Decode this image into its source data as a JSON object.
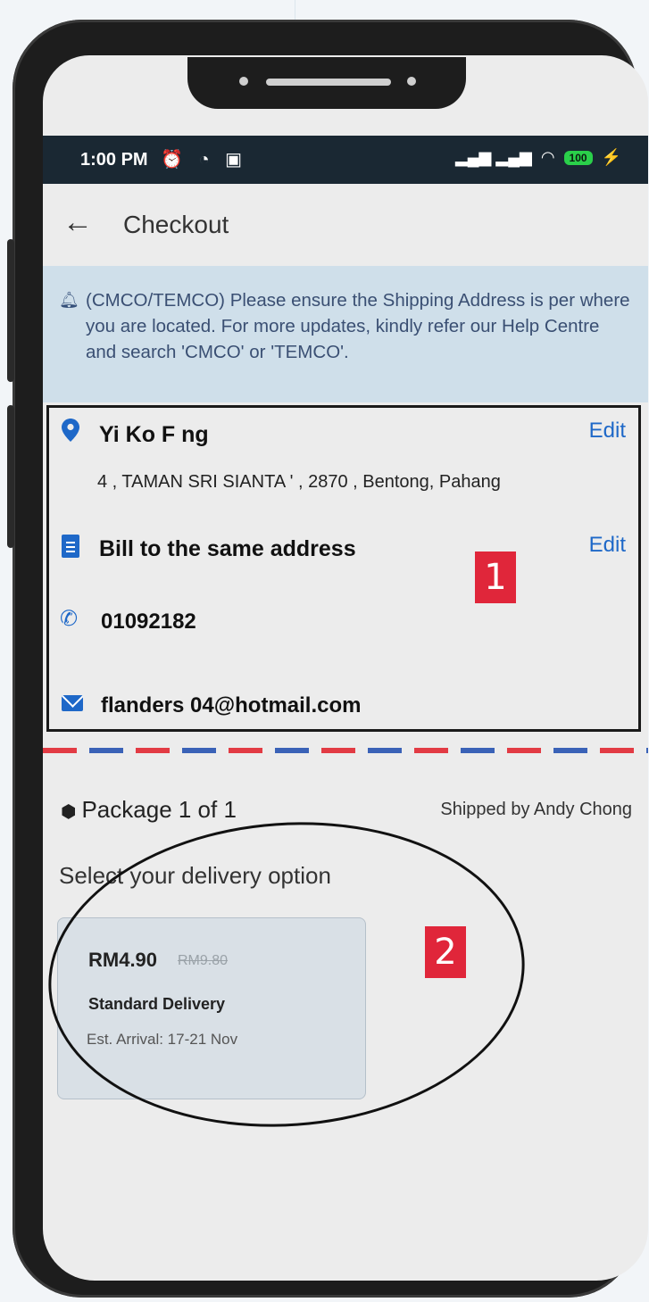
{
  "status_bar": {
    "time": "1:00 PM",
    "left_icons": "⏰ ◔ ▣",
    "signal": "▂▄▆ ▂▄▆",
    "wifi": "◠",
    "battery": "100",
    "charging": "⚡"
  },
  "header": {
    "back_icon": "arrow-left",
    "title": "Checkout"
  },
  "notice": {
    "icon": "bell",
    "text": "(CMCO/TEMCO) Please ensure the Shipping Address is per where you are located. For more updates, kindly refer our Help Centre and search 'CMCO' or 'TEMCO'."
  },
  "shipping": {
    "name": "Yi Ko F ng",
    "address": "4 , TAMAN SRI SIANTA ' , 2870 , Bentong, Pahang",
    "edit_label": "Edit",
    "billing_text": "Bill to the same address",
    "billing_edit_label": "Edit",
    "phone": "01092182",
    "email": "flanders 04@hotmail.com"
  },
  "badges": [
    "1",
    "2"
  ],
  "package": {
    "title": "Package 1 of 1",
    "shipped_by": "Shipped by Andy Chong",
    "select_prompt": "Select your delivery option",
    "option": {
      "price": "RM4.90",
      "old_price": "RM9.80",
      "name": "Standard Delivery",
      "arrival": "Est. Arrival: 17-21 Nov"
    }
  },
  "colors": {
    "accent_blue": "#1e68c8",
    "badge_red": "#e0263a",
    "notice_bg": "#cfdfea",
    "status_bg": "#1a2833"
  }
}
